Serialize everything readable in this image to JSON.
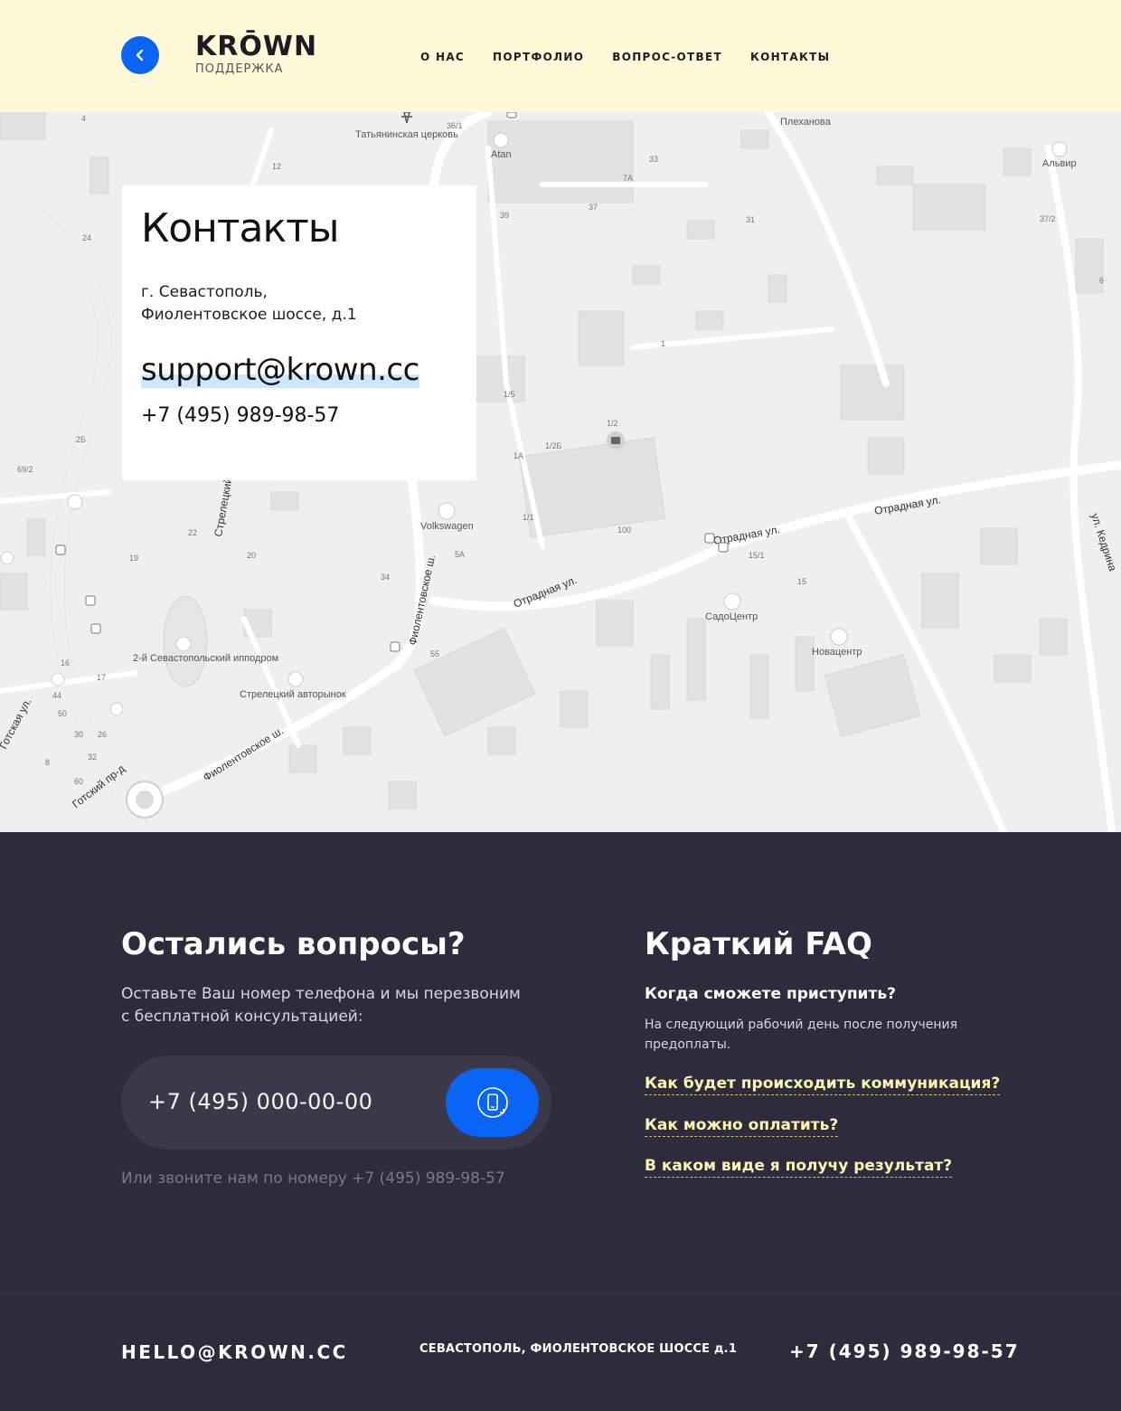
{
  "header": {
    "logo": "KRŌWN",
    "logo_sub": "ПОДДЕРЖКА",
    "nav": [
      "О НАС",
      "ПОРТФОЛИО",
      "ВОПРОС-ОТВЕТ",
      "КОНТАКТЫ"
    ]
  },
  "map": {
    "labels": [
      "Татьянинская церковь",
      "Atan",
      "Альвир",
      "Плеханова",
      "Volkswagen",
      "Отрадная ул.",
      "СадоЦентр",
      "Новацентр",
      "2-й Севастопольский ипподром",
      "Стрелецкий авторынок",
      "Фиолентовское ш.",
      "Готский пр-д",
      "Готская ул.",
      "ул. Кедрина",
      "Стрелецкий"
    ],
    "numbers": [
      "36/1",
      "33",
      "7А",
      "37",
      "31",
      "39",
      "1/5",
      "1/2",
      "1/2Б",
      "1А",
      "1/1",
      "100",
      "15/1",
      "15",
      "5А",
      "55",
      "34",
      "20",
      "22",
      "19",
      "24",
      "12",
      "2Б",
      "69/2",
      "37/2",
      "6",
      "4",
      "1",
      "17",
      "16",
      "44",
      "50",
      "30",
      "26",
      "32",
      "60",
      "8"
    ]
  },
  "contacts": {
    "title": "Контакты",
    "address_line1": "г. Севастополь,",
    "address_line2": "Фиолентовское шоссе, д.1",
    "email": "support@krown.cc",
    "phone": "+7 (495) 989-98-57"
  },
  "questions": {
    "title": "Остались вопросы?",
    "text_line1": "Оставьте Ваш номер телефона и мы перезвоним",
    "text_line2": "с бесплатной консультацией:",
    "input_placeholder": "+7 (495) 000-00-00",
    "alt": "Или звоните нам по номеру +7 (495) 989-98-57"
  },
  "faq": {
    "title": "Краткий FAQ",
    "question": "Когда сможете приступить?",
    "answer": "На следующий рабочий день после получения предоплаты.",
    "links": [
      "Как будет происходить коммуникация?",
      "Как можно оплатить?",
      "В каком виде я получу результат?"
    ]
  },
  "footer": {
    "email": "HELLO@KROWN.CC",
    "address": "СЕВАСТОПОЛЬ, ФИОЛЕНТОВСКОЕ ШОССЕ  д.1",
    "phone": "+7 (495) 989-98-57"
  },
  "colors": {
    "accent": "#0a64f5",
    "header_bg": "#fff9d8",
    "dark_bg": "#2d2b3c",
    "faq_link": "#fff4b0"
  }
}
